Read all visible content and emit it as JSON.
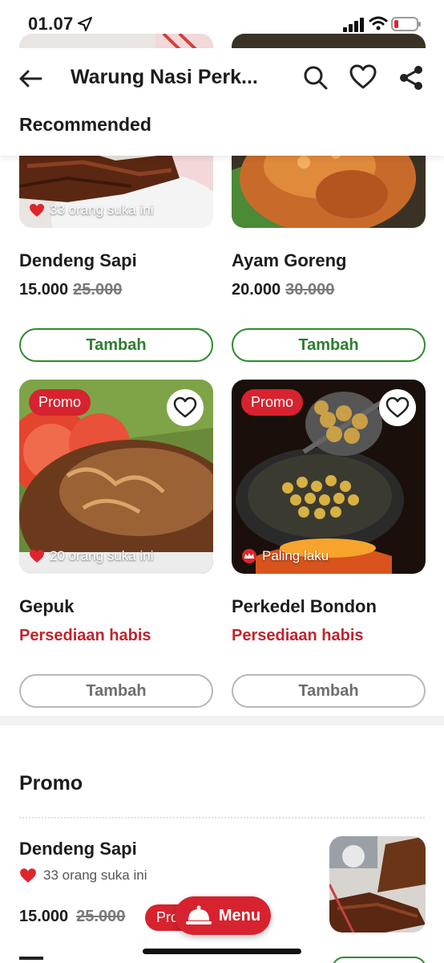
{
  "status": {
    "time": "01.07"
  },
  "header": {
    "title": "Warung Nasi Perk...",
    "section": "Recommended"
  },
  "cards": [
    {
      "name": "Dendeng Sapi",
      "price": "15.000",
      "old_price": "25.000",
      "likes": "33 orang suka ini",
      "button": "Tambah"
    },
    {
      "name": "Ayam Goreng",
      "price": "20.000",
      "old_price": "30.000",
      "button": "Tambah"
    },
    {
      "name": "Gepuk",
      "tag": "Promo",
      "likes": "20 orang suka ini",
      "status": "Persediaan habis",
      "button": "Tambah"
    },
    {
      "name": "Perkedel Bondon",
      "tag": "Promo",
      "badge": "Paling laku",
      "status": "Persediaan habis",
      "button": "Tambah"
    }
  ],
  "promo_section": {
    "title": "Promo",
    "item": {
      "name": "Dendeng Sapi",
      "likes": "33 orang suka ini",
      "price": "15.000",
      "old_price": "25.000",
      "tag": "Promo"
    }
  },
  "fab": {
    "label": "Menu"
  },
  "colors": {
    "accent_red": "#d7232f",
    "accent_green": "#2e8a2e"
  }
}
